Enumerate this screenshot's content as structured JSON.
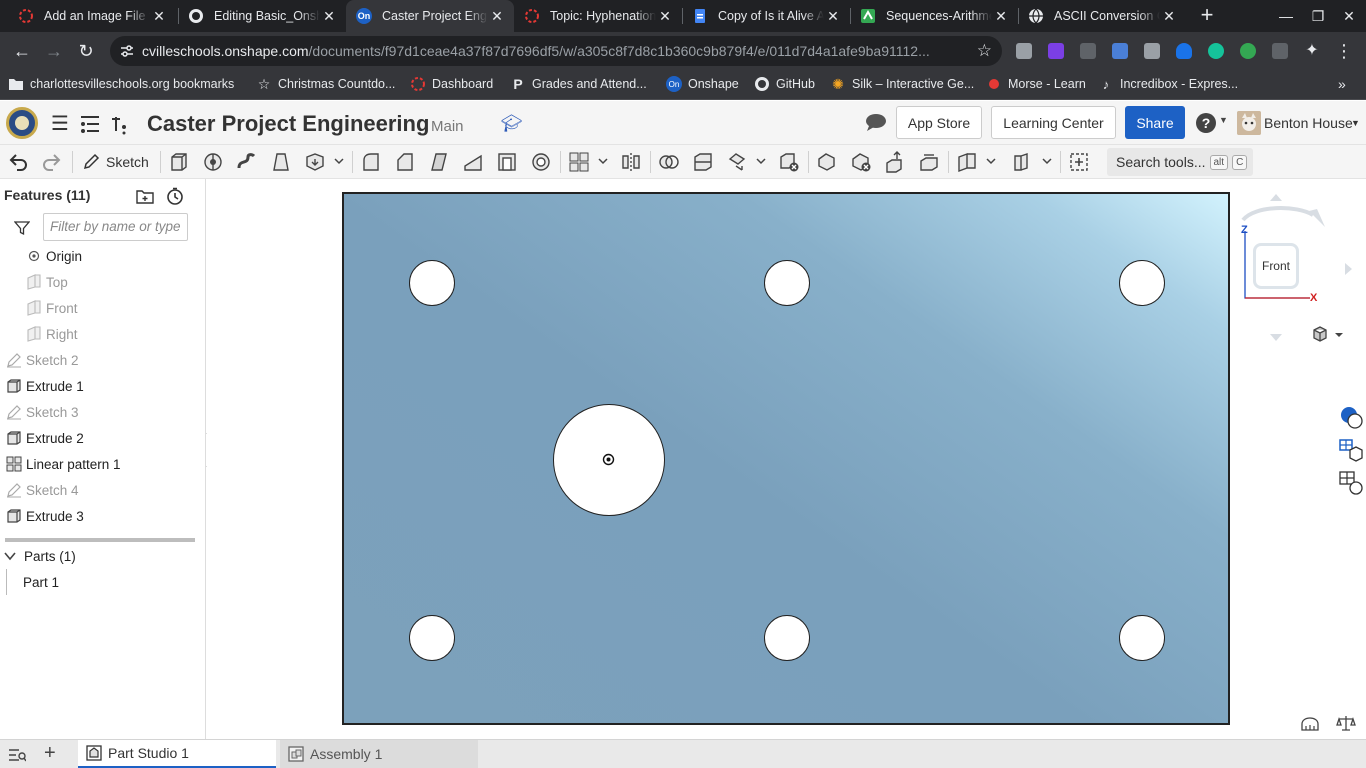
{
  "browser": {
    "tabs": [
      {
        "title": "Add an Image File t",
        "icon": "onshape-ring-icon"
      },
      {
        "title": "Editing Basic_Onsh",
        "icon": "github-icon"
      },
      {
        "title": "Caster Project Engi",
        "icon": "onshape-icon",
        "active": true
      },
      {
        "title": "Topic: Hyphenation",
        "icon": "onshape-ring-icon"
      },
      {
        "title": "Copy of Is it Alive A",
        "icon": "google-docs-icon"
      },
      {
        "title": "Sequences-Arithme",
        "icon": "reading-icon"
      },
      {
        "title": "ASCII Conversion C",
        "icon": "globe-icon"
      }
    ],
    "url_host": "cvilleschools.onshape.com",
    "url_path": "/documents/f97d1ceae4a37f87d7696df5/w/a305c8f7d8c1b360c9b879f4/e/011d7d4a1afe9ba91112...",
    "bookmarks": [
      {
        "label": "charlottesvilleschools.org bookmarks",
        "icon": "folder-icon"
      },
      {
        "label": "Christmas Countdo...",
        "icon": "star-icon"
      },
      {
        "label": "Dashboard",
        "icon": "dashboard-icon"
      },
      {
        "label": "Grades and Attend...",
        "icon": "powerschool-icon"
      },
      {
        "label": "Onshape",
        "icon": "onshape-icon"
      },
      {
        "label": "GitHub",
        "icon": "github-icon"
      },
      {
        "label": "Silk – Interactive Ge...",
        "icon": "silk-icon"
      },
      {
        "label": "Morse - Learn",
        "icon": "red-dot-icon"
      },
      {
        "label": "Incredibox - Expres...",
        "icon": "music-icon"
      }
    ]
  },
  "header": {
    "title": "Caster Project Engineering",
    "branch": "Main",
    "app_store": "App Store",
    "learning_center": "Learning Center",
    "share": "Share",
    "user_name": "Benton House"
  },
  "toolbar": {
    "sketch_label": "Sketch",
    "search_label": "Search tools...",
    "search_shortcut_1": "alt",
    "search_shortcut_2": "C"
  },
  "features": {
    "title": "Features (11)",
    "filter_placeholder": "Filter by name or type",
    "items": [
      {
        "label": "Origin",
        "icon": "origin-icon",
        "muted": false
      },
      {
        "label": "Top",
        "icon": "plane-icon",
        "muted": true
      },
      {
        "label": "Front",
        "icon": "plane-icon",
        "muted": true
      },
      {
        "label": "Right",
        "icon": "plane-icon",
        "muted": true
      },
      {
        "label": "Sketch 2",
        "icon": "sketch-pencil-icon",
        "muted": true
      },
      {
        "label": "Extrude 1",
        "icon": "extrude-icon",
        "muted": false
      },
      {
        "label": "Sketch 3",
        "icon": "sketch-pencil-icon",
        "muted": true
      },
      {
        "label": "Extrude 2",
        "icon": "extrude-icon",
        "muted": false
      },
      {
        "label": "Linear pattern 1",
        "icon": "linear-pattern-icon",
        "muted": false
      },
      {
        "label": "Sketch 4",
        "icon": "sketch-pencil-icon",
        "muted": true
      },
      {
        "label": "Extrude 3",
        "icon": "extrude-icon",
        "muted": false
      }
    ],
    "parts_title": "Parts (1)",
    "parts": [
      "Part 1"
    ]
  },
  "view_cube": {
    "face_label": "Front",
    "axis_z": "Z",
    "axis_x": "X"
  },
  "bottom_tabs": [
    {
      "label": "Part Studio 1",
      "active": true
    },
    {
      "label": "Assembly 1",
      "active": false
    }
  ],
  "colors": {
    "onshape_blue": "#1d61c5",
    "part_blue": "#7ca1bb"
  }
}
